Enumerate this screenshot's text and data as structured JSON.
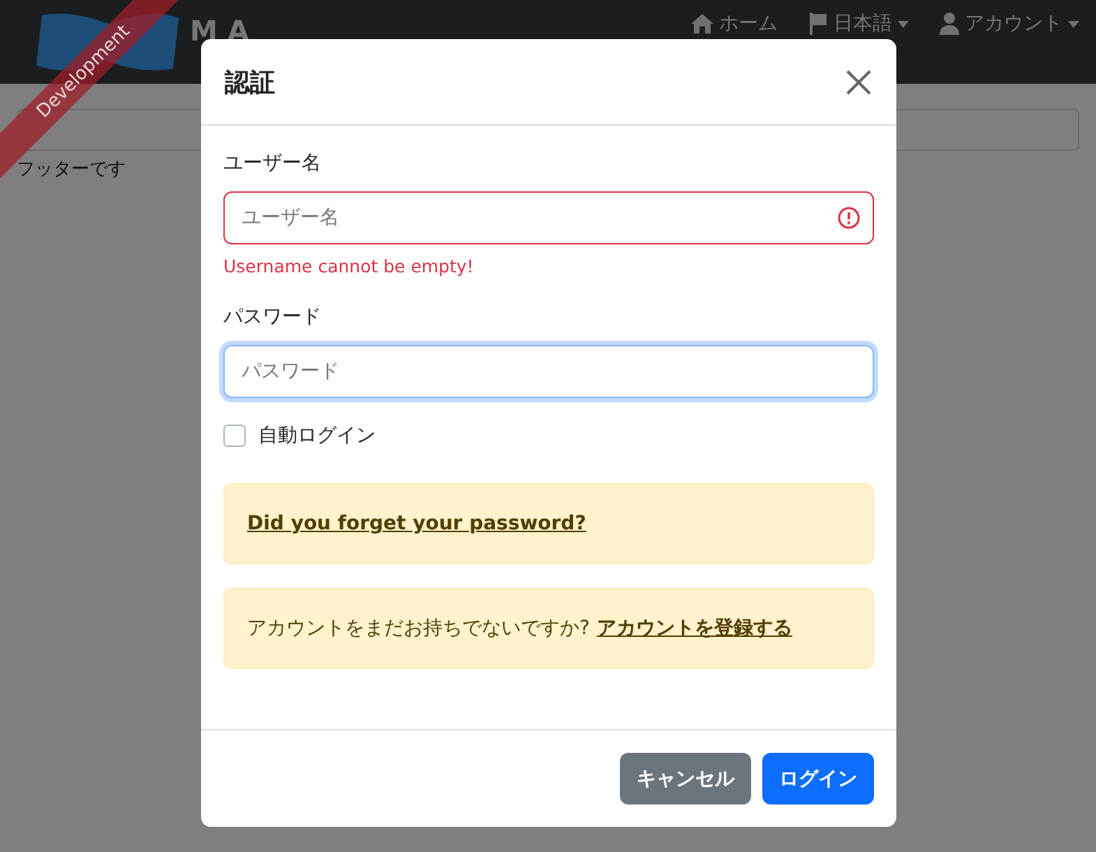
{
  "ribbon": {
    "label": "Development"
  },
  "navbar": {
    "logo_text": "M A",
    "items": [
      {
        "kind": "home",
        "label": "ホーム",
        "dropdown": false
      },
      {
        "kind": "flag",
        "label": "日本語",
        "dropdown": true
      },
      {
        "kind": "user",
        "label": "アカウント",
        "dropdown": true
      }
    ]
  },
  "page": {
    "footer": "フッターです"
  },
  "modal": {
    "title": "認証",
    "username": {
      "label": "ユーザー名",
      "placeholder": "ユーザー名",
      "invalid": true,
      "error": "Username cannot be empty!"
    },
    "password": {
      "label": "パスワード",
      "placeholder": "パスワード",
      "focused": true
    },
    "remember": {
      "label": "自動ログイン",
      "checked": false
    },
    "alerts": [
      {
        "link": "Did you forget your password?"
      },
      {
        "text": "アカウントをまだお持ちでないですか?",
        "link": "アカウントを登録する"
      }
    ],
    "buttons": [
      {
        "kind": "secondary",
        "label": "キャンセル"
      },
      {
        "kind": "primary",
        "label": "ログイン"
      }
    ]
  }
}
